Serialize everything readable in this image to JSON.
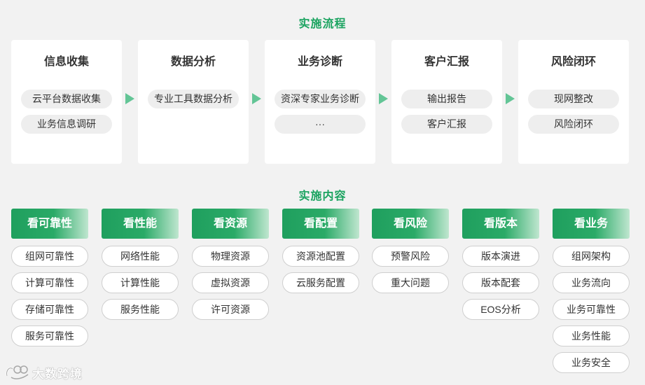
{
  "process": {
    "title": "实施流程",
    "steps": [
      {
        "title": "信息收集",
        "items": [
          "云平台数据收集",
          "业务信息调研"
        ]
      },
      {
        "title": "数据分析",
        "items": [
          "专业工具数据分析"
        ]
      },
      {
        "title": "业务诊断",
        "items": [
          "资深专家业务诊断",
          "···"
        ]
      },
      {
        "title": "客户汇报",
        "items": [
          "输出报告",
          "客户汇报"
        ]
      },
      {
        "title": "风险闭环",
        "items": [
          "现网整改",
          "风险闭环"
        ]
      }
    ]
  },
  "content": {
    "title": "实施内容",
    "columns": [
      {
        "title": "看可靠性",
        "items": [
          "组网可靠性",
          "计算可靠性",
          "存储可靠性",
          "服务可靠性"
        ]
      },
      {
        "title": "看性能",
        "items": [
          "网络性能",
          "计算性能",
          "服务性能"
        ]
      },
      {
        "title": "看资源",
        "items": [
          "物理资源",
          "虚拟资源",
          "许可资源"
        ]
      },
      {
        "title": "看配置",
        "items": [
          "资源池配置",
          "云服务配置"
        ]
      },
      {
        "title": "看风险",
        "items": [
          "预警风险",
          "重大问题"
        ]
      },
      {
        "title": "看版本",
        "items": [
          "版本演进",
          "版本配套",
          "EOS分析"
        ]
      },
      {
        "title": "看业务",
        "items": [
          "组网架构",
          "业务流向",
          "业务可靠性",
          "业务性能",
          "业务安全"
        ]
      }
    ]
  },
  "watermark": {
    "text": "大数跨境"
  },
  "colors": {
    "accent": "#1aa35f",
    "arrow": "#63c596",
    "header_start": "#1f9f5e",
    "header_end": "#bfe6cf"
  }
}
